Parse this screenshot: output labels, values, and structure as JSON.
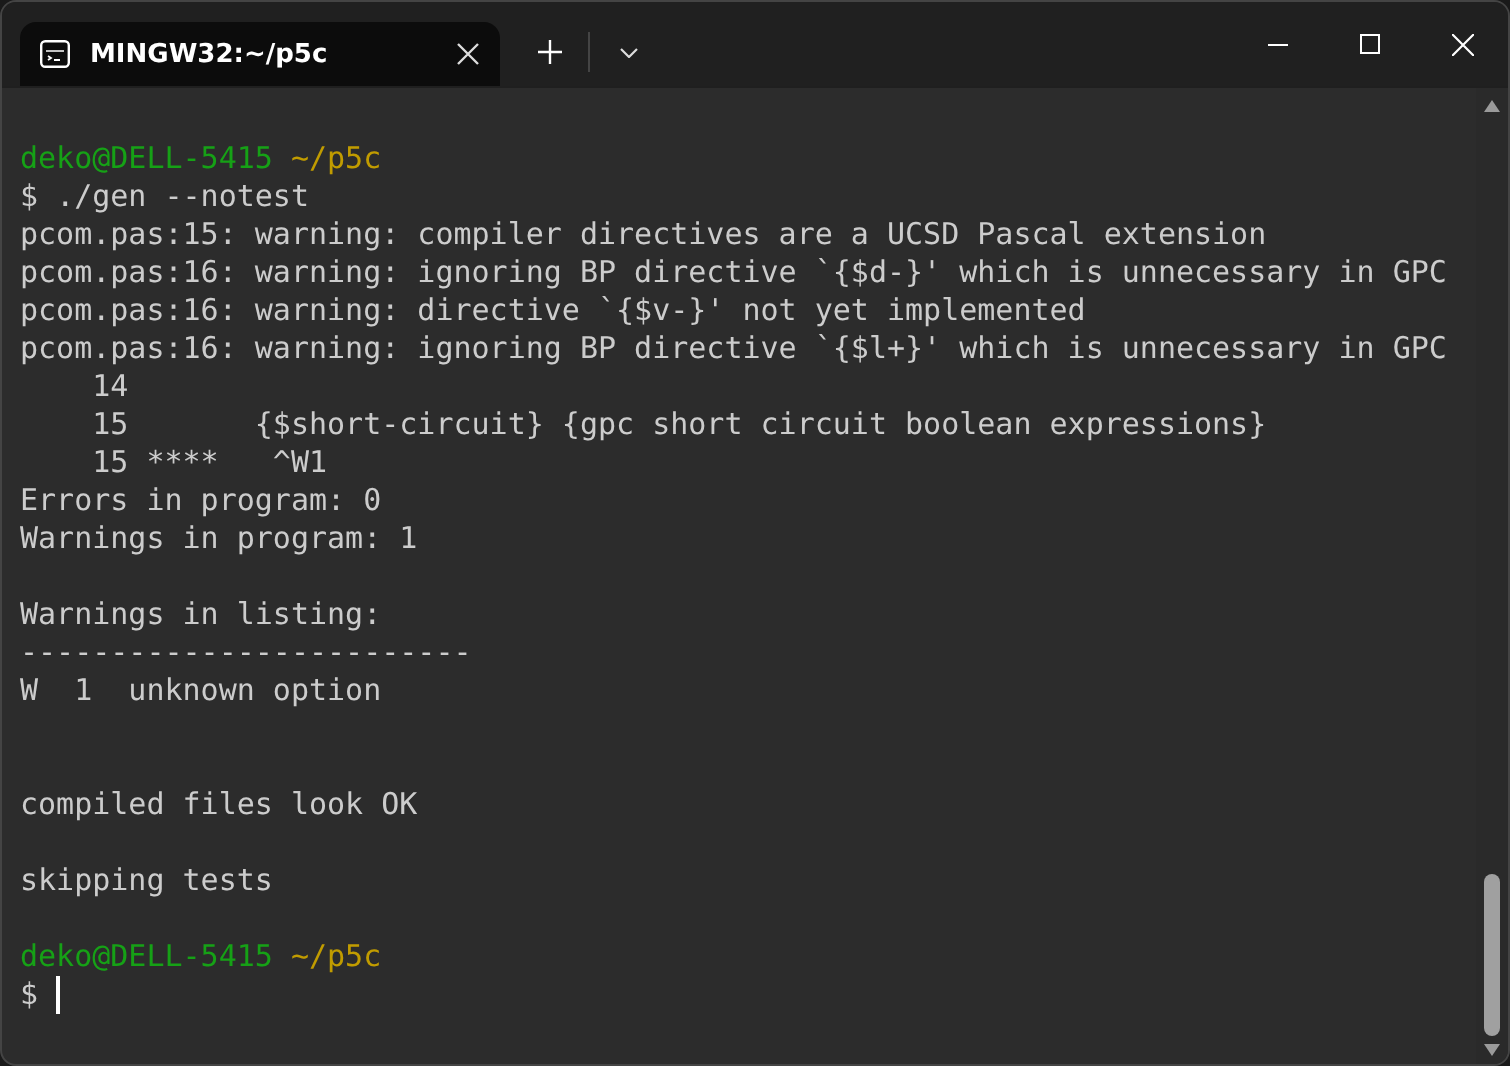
{
  "window": {
    "tabs": [
      {
        "title": "MINGW32:~/p5c",
        "selected": true
      }
    ]
  },
  "terminal": {
    "lines": [
      {
        "kind": "prompt",
        "user": "deko@DELL-5415",
        "path": "~/p5c"
      },
      {
        "kind": "command",
        "symbol": "$",
        "text": "./gen --notest"
      },
      {
        "kind": "output",
        "text": "pcom.pas:15: warning: compiler directives are a UCSD Pascal extension"
      },
      {
        "kind": "output",
        "text": "pcom.pas:16: warning: ignoring BP directive `{$d-}' which is unnecessary in GPC"
      },
      {
        "kind": "output",
        "text": "pcom.pas:16: warning: directive `{$v-}' not yet implemented"
      },
      {
        "kind": "output",
        "text": "pcom.pas:16: warning: ignoring BP directive `{$l+}' which is unnecessary in GPC"
      },
      {
        "kind": "output",
        "text": "    14"
      },
      {
        "kind": "output",
        "text": "    15       {$short-circuit} {gpc short circuit boolean expressions}"
      },
      {
        "kind": "output",
        "text": "    15 ****   ^W1"
      },
      {
        "kind": "output",
        "text": "Errors in program: 0"
      },
      {
        "kind": "output",
        "text": "Warnings in program: 1"
      },
      {
        "kind": "blank"
      },
      {
        "kind": "output",
        "text": "Warnings in listing:"
      },
      {
        "kind": "output",
        "text": "-------------------------"
      },
      {
        "kind": "output",
        "text": "W  1  unknown option"
      },
      {
        "kind": "blank"
      },
      {
        "kind": "blank"
      },
      {
        "kind": "output",
        "text": "compiled files look OK"
      },
      {
        "kind": "blank"
      },
      {
        "kind": "output",
        "text": "skipping tests"
      },
      {
        "kind": "blank"
      },
      {
        "kind": "prompt",
        "user": "deko@DELL-5415",
        "path": "~/p5c"
      },
      {
        "kind": "cursor",
        "symbol": "$"
      }
    ]
  }
}
